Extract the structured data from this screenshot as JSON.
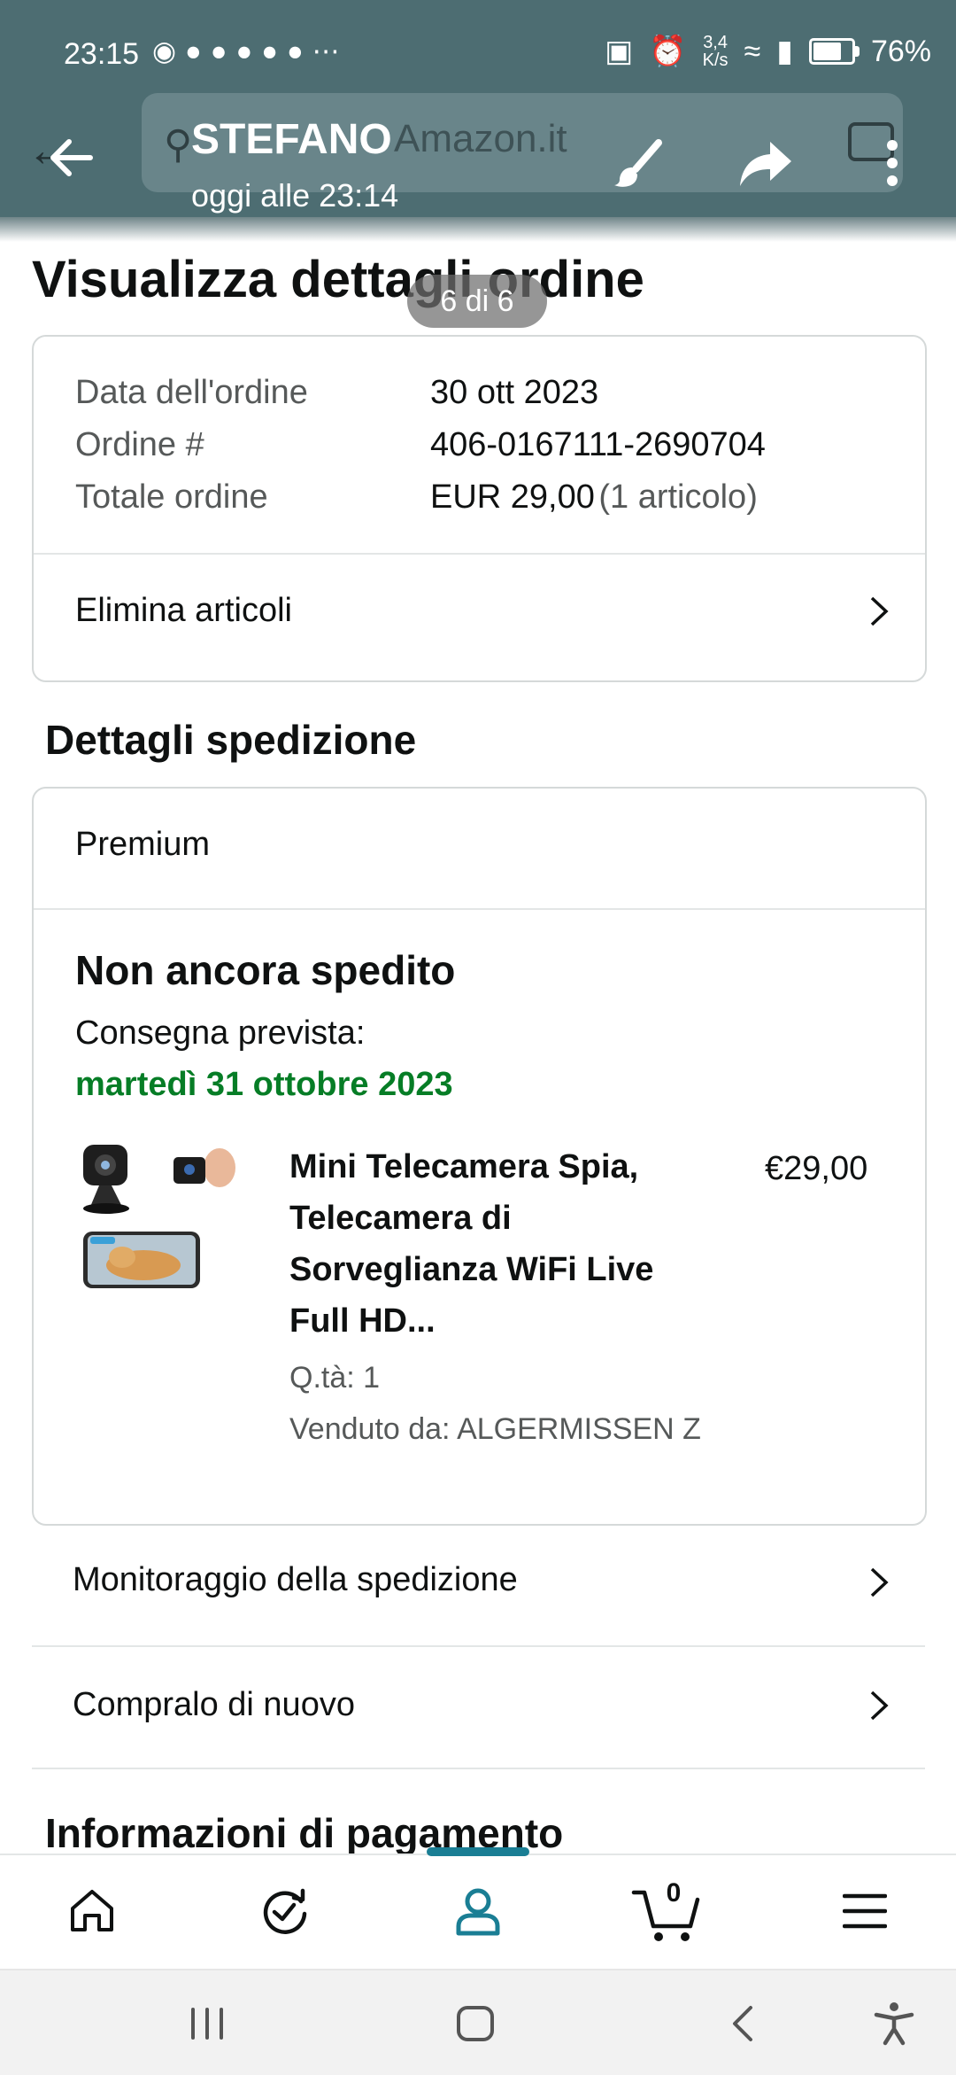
{
  "status_bar": {
    "time": "23:15",
    "speed_value": "3,4",
    "speed_unit": "K/s",
    "battery": "76%",
    "battery_level": 0.76
  },
  "viewer": {
    "sender": "STEFANO",
    "date": "oggi alle 23:14",
    "page_counter": "6 di 6"
  },
  "amazon_header": {
    "search_placeholder": "Amazon.it"
  },
  "page": {
    "title": "Visualizza dettagli ordine"
  },
  "order": {
    "date_label": "Data dell'ordine",
    "date_value": "30 ott 2023",
    "number_label": "Ordine #",
    "number_value": "406-0167111-2690704",
    "total_label": "Totale ordine",
    "total_value": "EUR 29,00",
    "total_items": "(1 articolo)",
    "delete_link": "Elimina articoli"
  },
  "shipping": {
    "section_title": "Dettagli spedizione",
    "service": "Premium",
    "status": "Non ancora spedito",
    "delivery_label": "Consegna prevista:",
    "delivery_date": "martedì 31 ottobre 2023",
    "product_title": "Mini Telecamera Spia, Telecamera di Sorveglianza WiFi Live Full HD...",
    "product_price": "€29,00",
    "quantity": "Q.tà: 1",
    "seller": "Venduto da: ALGERMISSEN Z"
  },
  "actions": {
    "track": "Monitoraggio della spedizione",
    "buy_again": "Compralo di nuovo"
  },
  "payment": {
    "section_title": "Informazioni di pagamento"
  },
  "bottom_nav": {
    "cart_count": "0",
    "active_tab": "account"
  },
  "colors": {
    "accent": "#1a7e94",
    "delivery_green": "#067d26",
    "overlay": "#4d6d72"
  }
}
